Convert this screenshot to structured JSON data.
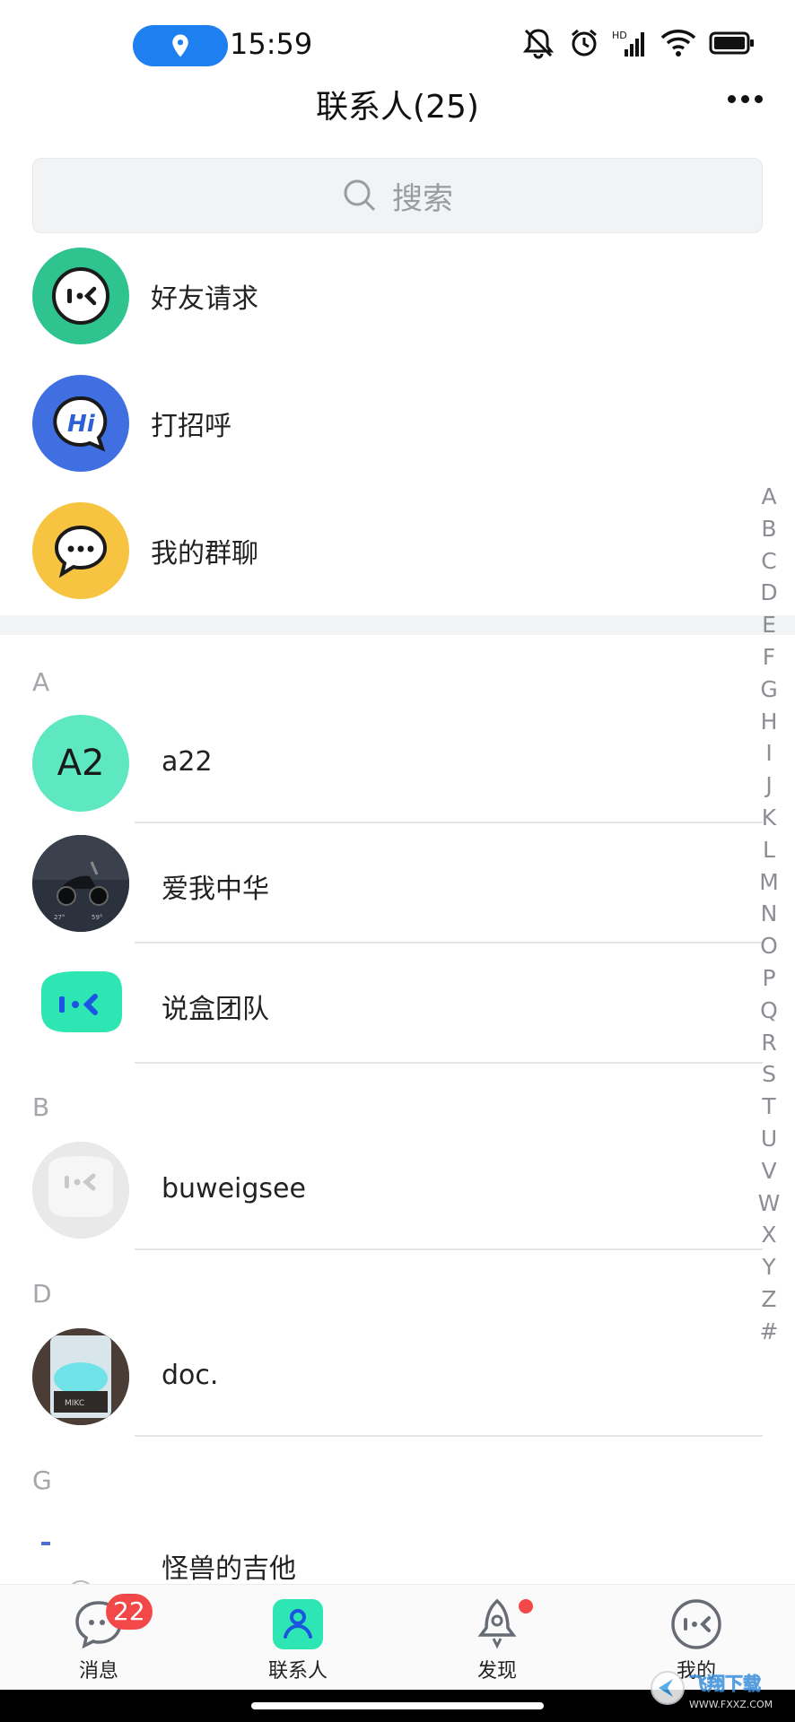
{
  "status_bar": {
    "time": "15:59"
  },
  "header": {
    "title": "联系人(25)"
  },
  "search": {
    "placeholder": "搜索"
  },
  "functions": [
    {
      "label": "好友请求",
      "color": "#2fc48f"
    },
    {
      "label": "打招呼",
      "color": "#3f6fe0"
    },
    {
      "label": "我的群聊",
      "color": "#f7c441"
    }
  ],
  "sections": [
    {
      "letter": "A",
      "contacts": [
        {
          "name": "a22",
          "avatar_text": "A2",
          "avatar_color": "#5ee8c2"
        },
        {
          "name": "爱我中华"
        },
        {
          "name": "说盒团队"
        }
      ]
    },
    {
      "letter": "B",
      "contacts": [
        {
          "name": "buweigsee"
        }
      ]
    },
    {
      "letter": "D",
      "contacts": [
        {
          "name": "doc."
        }
      ]
    },
    {
      "letter": "G",
      "contacts": [
        {
          "name": "怪兽的吉他"
        }
      ]
    }
  ],
  "alpha_index": [
    "A",
    "B",
    "C",
    "D",
    "E",
    "F",
    "G",
    "H",
    "I",
    "J",
    "K",
    "L",
    "M",
    "N",
    "O",
    "P",
    "Q",
    "R",
    "S",
    "T",
    "U",
    "V",
    "W",
    "X",
    "Y",
    "Z",
    "#"
  ],
  "tabs": [
    {
      "label": "消息",
      "badge": "22"
    },
    {
      "label": "联系人"
    },
    {
      "label": "发现"
    },
    {
      "label": "我的"
    }
  ],
  "colors": {
    "accent": "#1e7ff0",
    "brand": "#2ee6b4",
    "badge": "#f24848"
  },
  "watermark": {
    "text": "飞翔下载",
    "domain": "WWW.FXXZ.COM"
  }
}
